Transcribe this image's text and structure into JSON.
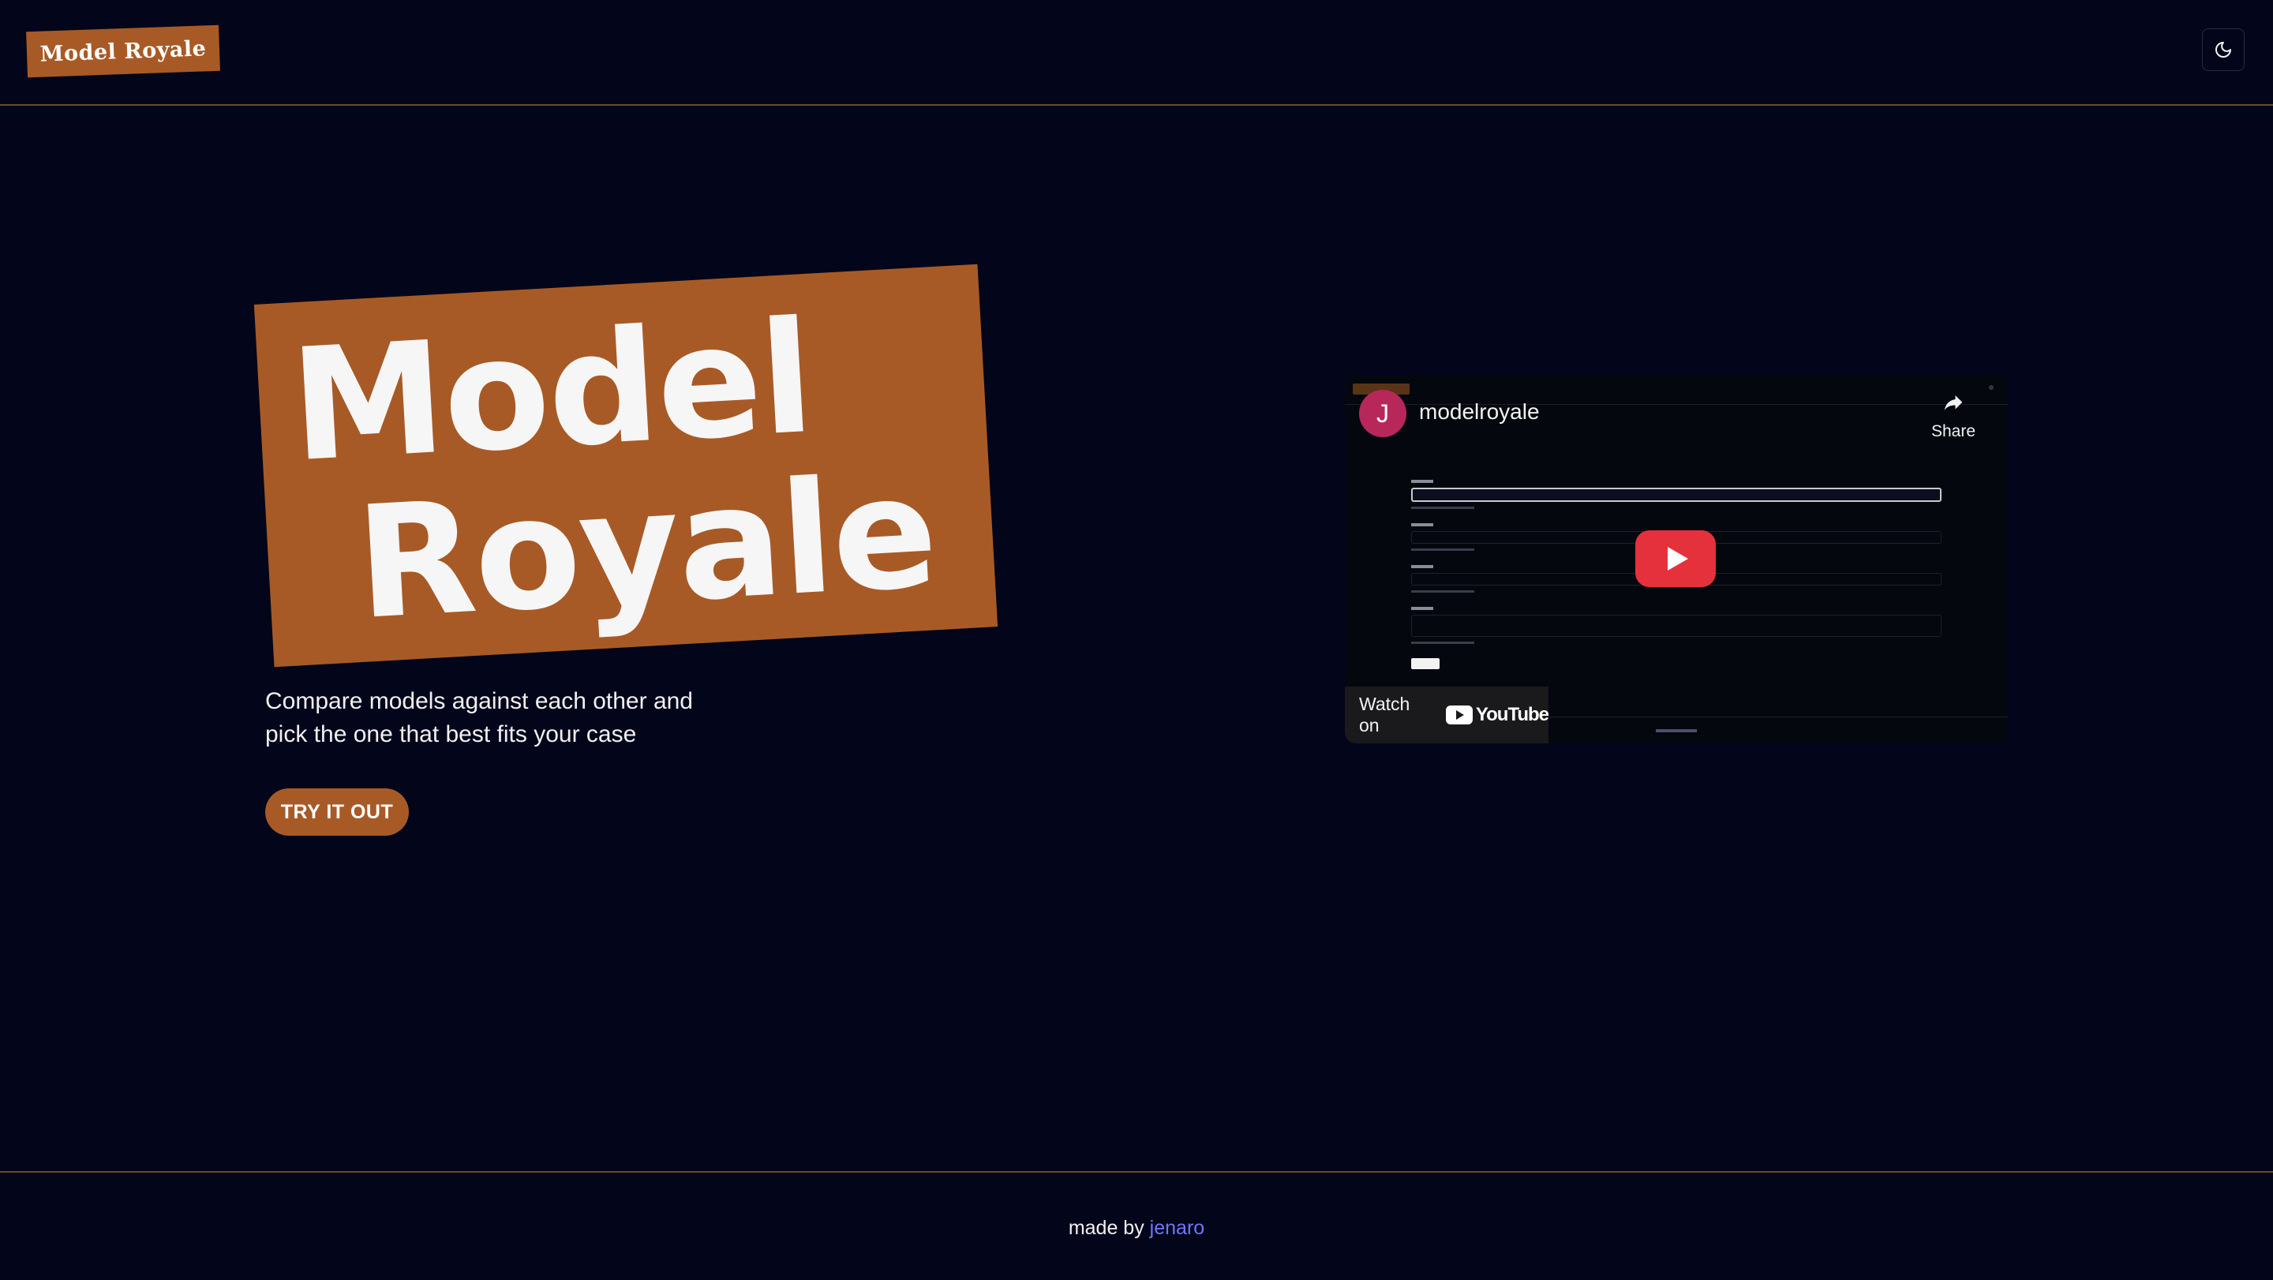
{
  "header": {
    "logo_text": "Model Royale",
    "theme_toggle_icon": "moon-icon"
  },
  "hero": {
    "title_line1": "Model",
    "title_line2": "Royale",
    "subtitle_line1": "Compare models against each other and",
    "subtitle_line2": "pick the one that best fits your case",
    "cta_label": "TRY IT OUT"
  },
  "video": {
    "avatar_letter": "J",
    "channel_name": "modelroyale",
    "share_label": "Share",
    "watch_on_label": "Watch on",
    "youtube_wordmark": "YouTube",
    "play_icon": "play-icon"
  },
  "footer": {
    "made_by": "made by",
    "author": "jenaro"
  },
  "colors": {
    "background": "#03061a",
    "accent": "#a85a26",
    "link": "#6f76ff",
    "youtube_red": "#e5313c"
  }
}
